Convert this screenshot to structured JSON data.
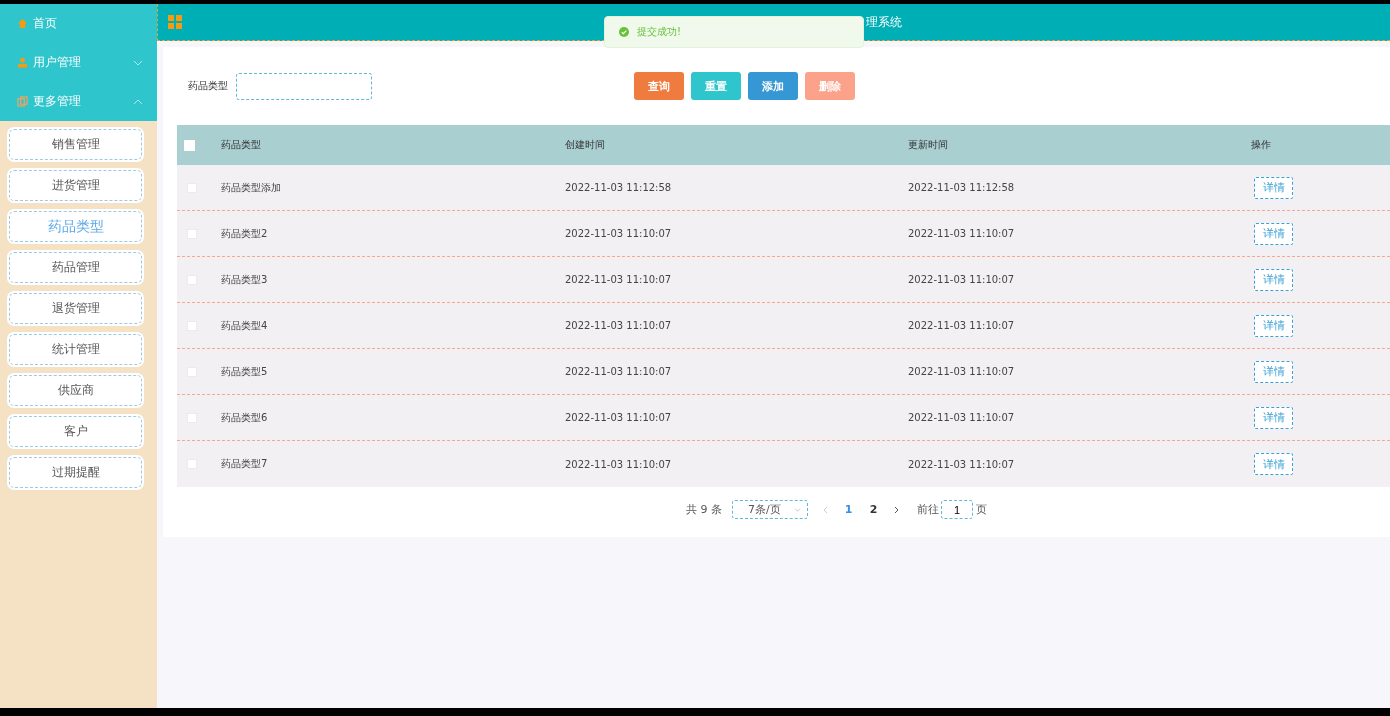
{
  "sidebar": {
    "top_items": [
      {
        "label": "首页",
        "kind": "home"
      },
      {
        "label": "用户管理",
        "kind": "user",
        "expanded": false
      },
      {
        "label": "更多管理",
        "kind": "more",
        "expanded": true
      }
    ],
    "sub_items": [
      {
        "label": "销售管理",
        "selected": false
      },
      {
        "label": "进货管理",
        "selected": false
      },
      {
        "label": "药品类型",
        "selected": true
      },
      {
        "label": "药品管理",
        "selected": false
      },
      {
        "label": "退货管理",
        "selected": false
      },
      {
        "label": "统计管理",
        "selected": false
      },
      {
        "label": "供应商",
        "selected": false
      },
      {
        "label": "客户",
        "selected": false
      },
      {
        "label": "过期提醒",
        "selected": false
      }
    ]
  },
  "header": {
    "title": "理系统"
  },
  "toast": {
    "message": "提交成功!"
  },
  "search": {
    "label": "药品类型",
    "buttons": [
      {
        "label": "查询",
        "color": "#f07b3f"
      },
      {
        "label": "重置",
        "color": "#2ec5cc"
      },
      {
        "label": "添加",
        "color": "#3597d3"
      },
      {
        "label": "删除",
        "color": "#fca28a"
      }
    ]
  },
  "table": {
    "columns": [
      "药品类型",
      "创建时间",
      "更新时间",
      "操作"
    ],
    "header_checked": false,
    "rows": [
      {
        "name": "药品类型添加",
        "created": "2022-11-03 11:12:58",
        "updated": "2022-11-03 11:12:58",
        "action": "详情",
        "checked": false
      },
      {
        "name": "药品类型2",
        "created": "2022-11-03 11:10:07",
        "updated": "2022-11-03 11:10:07",
        "action": "详情",
        "checked": false
      },
      {
        "name": "药品类型3",
        "created": "2022-11-03 11:10:07",
        "updated": "2022-11-03 11:10:07",
        "action": "详情",
        "checked": false
      },
      {
        "name": "药品类型4",
        "created": "2022-11-03 11:10:07",
        "updated": "2022-11-03 11:10:07",
        "action": "详情",
        "checked": false
      },
      {
        "name": "药品类型5",
        "created": "2022-11-03 11:10:07",
        "updated": "2022-11-03 11:10:07",
        "action": "详情",
        "checked": false
      },
      {
        "name": "药品类型6",
        "created": "2022-11-03 11:10:07",
        "updated": "2022-11-03 11:10:07",
        "action": "详情",
        "checked": false
      },
      {
        "name": "药品类型7",
        "created": "2022-11-03 11:10:07",
        "updated": "2022-11-03 11:10:07",
        "action": "详情",
        "checked": false
      }
    ]
  },
  "pagination": {
    "total": "共 9 条",
    "page_size": "7条/页",
    "pages": [
      {
        "label": "1",
        "selected": true
      },
      {
        "label": "2",
        "selected": false
      }
    ],
    "goto_label": "前往",
    "goto_value": "1",
    "goto_suffix": "页"
  }
}
